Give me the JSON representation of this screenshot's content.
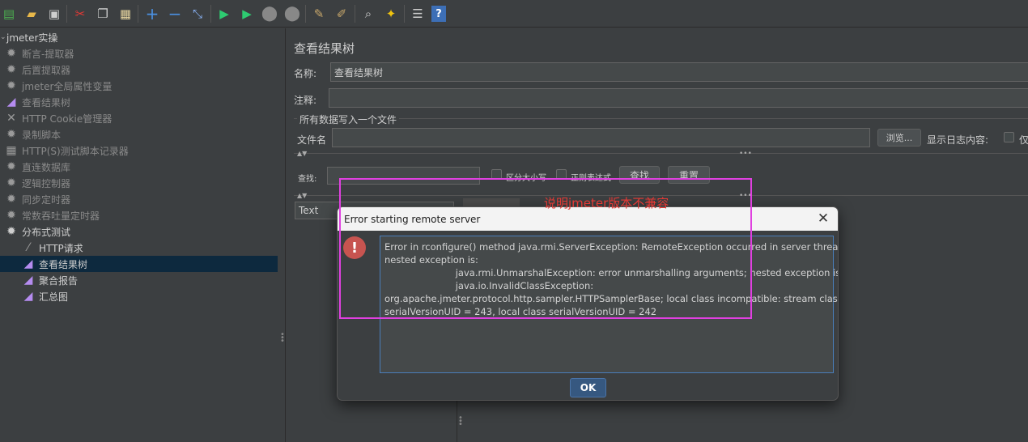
{
  "toolbar": {
    "icons": [
      "templates-icon",
      "open-icon",
      "save-icon",
      "cut-icon",
      "copy-icon",
      "paste-icon",
      "expand-icon",
      "collapse-icon",
      "toggle-icon",
      "start-icon",
      "start-no-pause-icon",
      "stop-icon",
      "shutdown-icon",
      "clear-icon",
      "clear-all-icon",
      "search-icon",
      "reset-search-icon",
      "function-helper-icon",
      "help-icon"
    ]
  },
  "tree": {
    "root": "jmeter实操",
    "items": [
      {
        "label": "断言-提取器",
        "icon": "gear"
      },
      {
        "label": "后置提取器",
        "icon": "gear"
      },
      {
        "label": "jmeter全局属性变量",
        "icon": "gear"
      },
      {
        "label": "查看结果树",
        "icon": "chart"
      },
      {
        "label": "HTTP Cookie管理器",
        "icon": "tools"
      },
      {
        "label": "录制脚本",
        "icon": "gear"
      },
      {
        "label": "HTTP(S)测试脚本记录器",
        "icon": "recorder"
      },
      {
        "label": "直连数据库",
        "icon": "gear"
      },
      {
        "label": "逻辑控制器",
        "icon": "gear"
      },
      {
        "label": "同步定时器",
        "icon": "gear"
      },
      {
        "label": "常数吞吐量定时器",
        "icon": "gear"
      },
      {
        "label": "分布式测试",
        "icon": "gear"
      },
      {
        "label": "HTTP请求",
        "icon": "pipette"
      },
      {
        "label": "查看结果树",
        "icon": "chart"
      },
      {
        "label": "聚合报告",
        "icon": "chart"
      },
      {
        "label": "汇总图",
        "icon": "chart"
      }
    ]
  },
  "panel": {
    "title": "查看结果树",
    "name_label": "名称:",
    "name_value": "查看结果树",
    "comment_label": "注释:",
    "comment_value": "",
    "file_section": "所有数据写入一个文件",
    "filename_label": "文件名",
    "filename_value": "",
    "browse_label": "浏览...",
    "log_label": "显示日志内容:",
    "only_label": "仅",
    "search_label": "查找:",
    "case_label": "区分大小写",
    "regex_label": "正则表达式",
    "find_button": "查找",
    "reset_button": "重置",
    "renderer_value": "Text"
  },
  "dialog": {
    "title": "Error starting remote server",
    "message_lines": [
      "Error in rconfigure() method java.rmi.ServerException: RemoteException occurred in server thread;",
      "nested exception is:",
      "                        java.rmi.UnmarshalException: error unmarshalling arguments; nested exception is:",
      "                        java.io.InvalidClassException:",
      "org.apache.jmeter.protocol.http.sampler.HTTPSamplerBase; local class incompatible: stream classdesc",
      "serialVersionUID = 243, local class serialVersionUID = 242"
    ],
    "ok_label": "OK"
  },
  "annotation": {
    "text": "说明jmeter版本不兼容",
    "color": "#e53935",
    "box_color": "#e040e0"
  }
}
